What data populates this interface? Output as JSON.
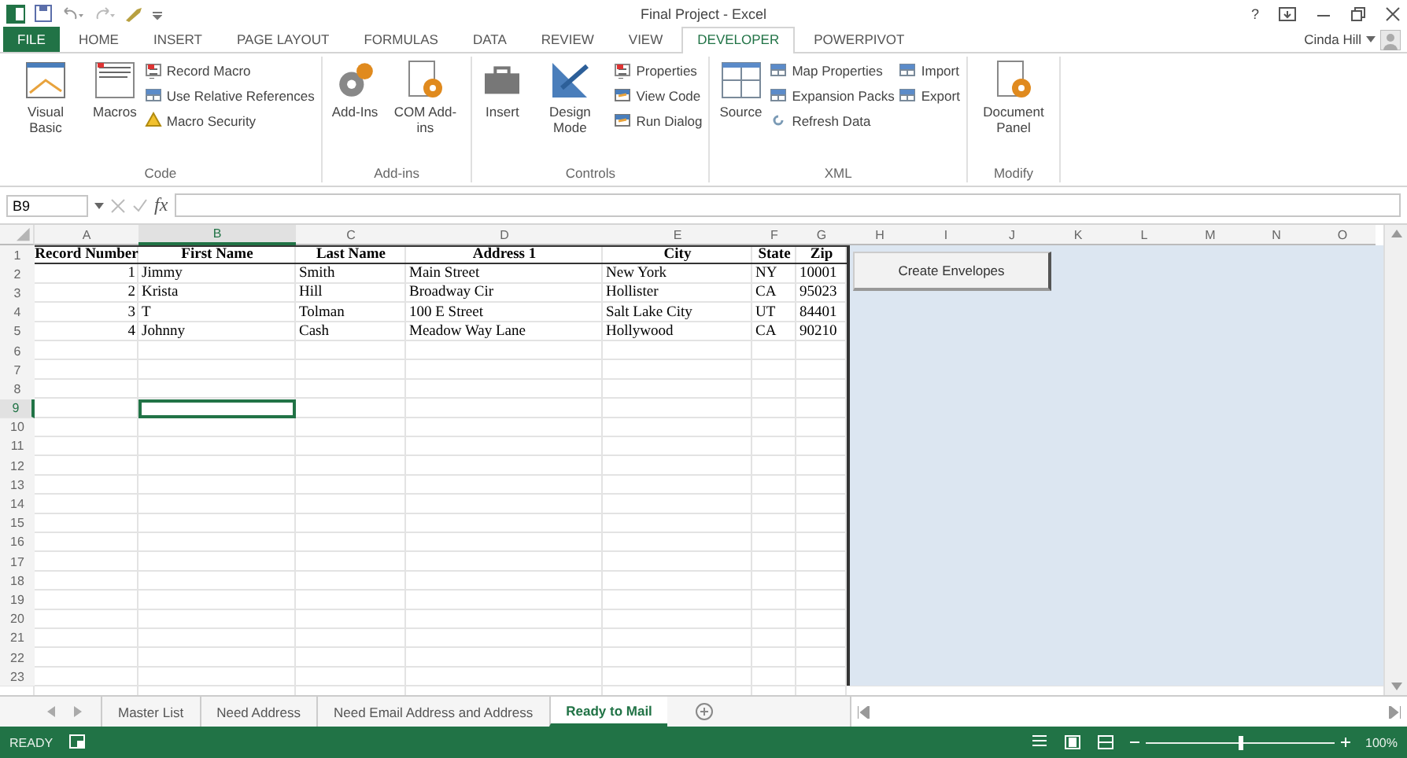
{
  "window": {
    "title": "Final Project - Excel",
    "help": "?"
  },
  "ribbon": {
    "tabs": [
      {
        "label": "FILE",
        "selected": false,
        "kind": "file"
      },
      {
        "label": "HOME",
        "selected": false,
        "kind": "tab"
      },
      {
        "label": "INSERT",
        "selected": false,
        "kind": "tab"
      },
      {
        "label": "PAGE LAYOUT",
        "selected": false,
        "kind": "tab"
      },
      {
        "label": "FORMULAS",
        "selected": false,
        "kind": "tab"
      },
      {
        "label": "DATA",
        "selected": false,
        "kind": "tab"
      },
      {
        "label": "REVIEW",
        "selected": false,
        "kind": "tab"
      },
      {
        "label": "VIEW",
        "selected": false,
        "kind": "tab"
      },
      {
        "label": "DEVELOPER",
        "selected": true,
        "kind": "tab"
      },
      {
        "label": "POWERPIVOT",
        "selected": false,
        "kind": "tab"
      }
    ],
    "account": "Cinda Hill",
    "groups": [
      {
        "label": "Code",
        "items": [
          {
            "kind": "large",
            "label": "Visual Basic"
          },
          {
            "kind": "large",
            "label": "Macros"
          },
          {
            "kind": "stack",
            "buttons": [
              "Record Macro",
              "Use Relative References",
              "Macro Security"
            ]
          }
        ]
      },
      {
        "label": "Add-ins",
        "items": [
          {
            "kind": "large",
            "label": "Add-Ins"
          },
          {
            "kind": "large",
            "label": "COM Add-ins"
          }
        ]
      },
      {
        "label": "Controls",
        "items": [
          {
            "kind": "large",
            "label": "Insert"
          },
          {
            "kind": "large",
            "label": "Design Mode"
          },
          {
            "kind": "stack",
            "buttons": [
              "Properties",
              "View Code",
              "Run Dialog"
            ]
          }
        ]
      },
      {
        "label": "XML",
        "items": [
          {
            "kind": "large",
            "label": "Source"
          },
          {
            "kind": "stack",
            "buttons": [
              "Map Properties",
              "Expansion Packs",
              "Refresh Data"
            ]
          },
          {
            "kind": "stack",
            "buttons": [
              "Import",
              "Export"
            ]
          }
        ]
      },
      {
        "label": "Modify",
        "items": [
          {
            "kind": "large",
            "label": "Document Panel"
          }
        ]
      }
    ]
  },
  "formula_bar": {
    "name_box": "B9",
    "function_label": "fx"
  },
  "sheet": {
    "columns": [
      "A",
      "B",
      "C",
      "D",
      "E",
      "F",
      "G",
      "H",
      "I",
      "J",
      "K",
      "L",
      "M",
      "N",
      "O"
    ],
    "row_numbers": [
      "1",
      "2",
      "3",
      "4",
      "5",
      "6",
      "7",
      "8",
      "9",
      "10",
      "11",
      "12",
      "13",
      "14",
      "15",
      "16",
      "17",
      "18",
      "19",
      "20",
      "21",
      "22",
      "23"
    ],
    "header": [
      "Record Number",
      "First Name",
      "Last Name",
      "Address 1",
      "City",
      "State",
      "Zip"
    ],
    "rows": [
      [
        "1",
        "Jimmy",
        "Smith",
        "Main Street",
        "New York",
        "NY",
        "10001"
      ],
      [
        "2",
        "Krista",
        "Hill",
        "Broadway Cir",
        "Hollister",
        "CA",
        "95023"
      ],
      [
        "3",
        "T",
        "Tolman",
        "100 E Street",
        "Salt Lake City",
        "UT",
        "84401"
      ],
      [
        "4",
        "Johnny",
        "Cash",
        "Meadow Way Lane",
        "Hollywood",
        "CA",
        "90210"
      ]
    ],
    "button": "Create Envelopes"
  },
  "sheet_tabs": [
    {
      "label": "Master List",
      "selected": false
    },
    {
      "label": "Need Address",
      "selected": false
    },
    {
      "label": "Need Email Address and Address",
      "selected": false
    },
    {
      "label": "Ready to Mail",
      "selected": true
    }
  ],
  "status_bar": {
    "status": "READY",
    "zoom": {
      "level": 0.5
    },
    "zoom_label": "100%"
  }
}
